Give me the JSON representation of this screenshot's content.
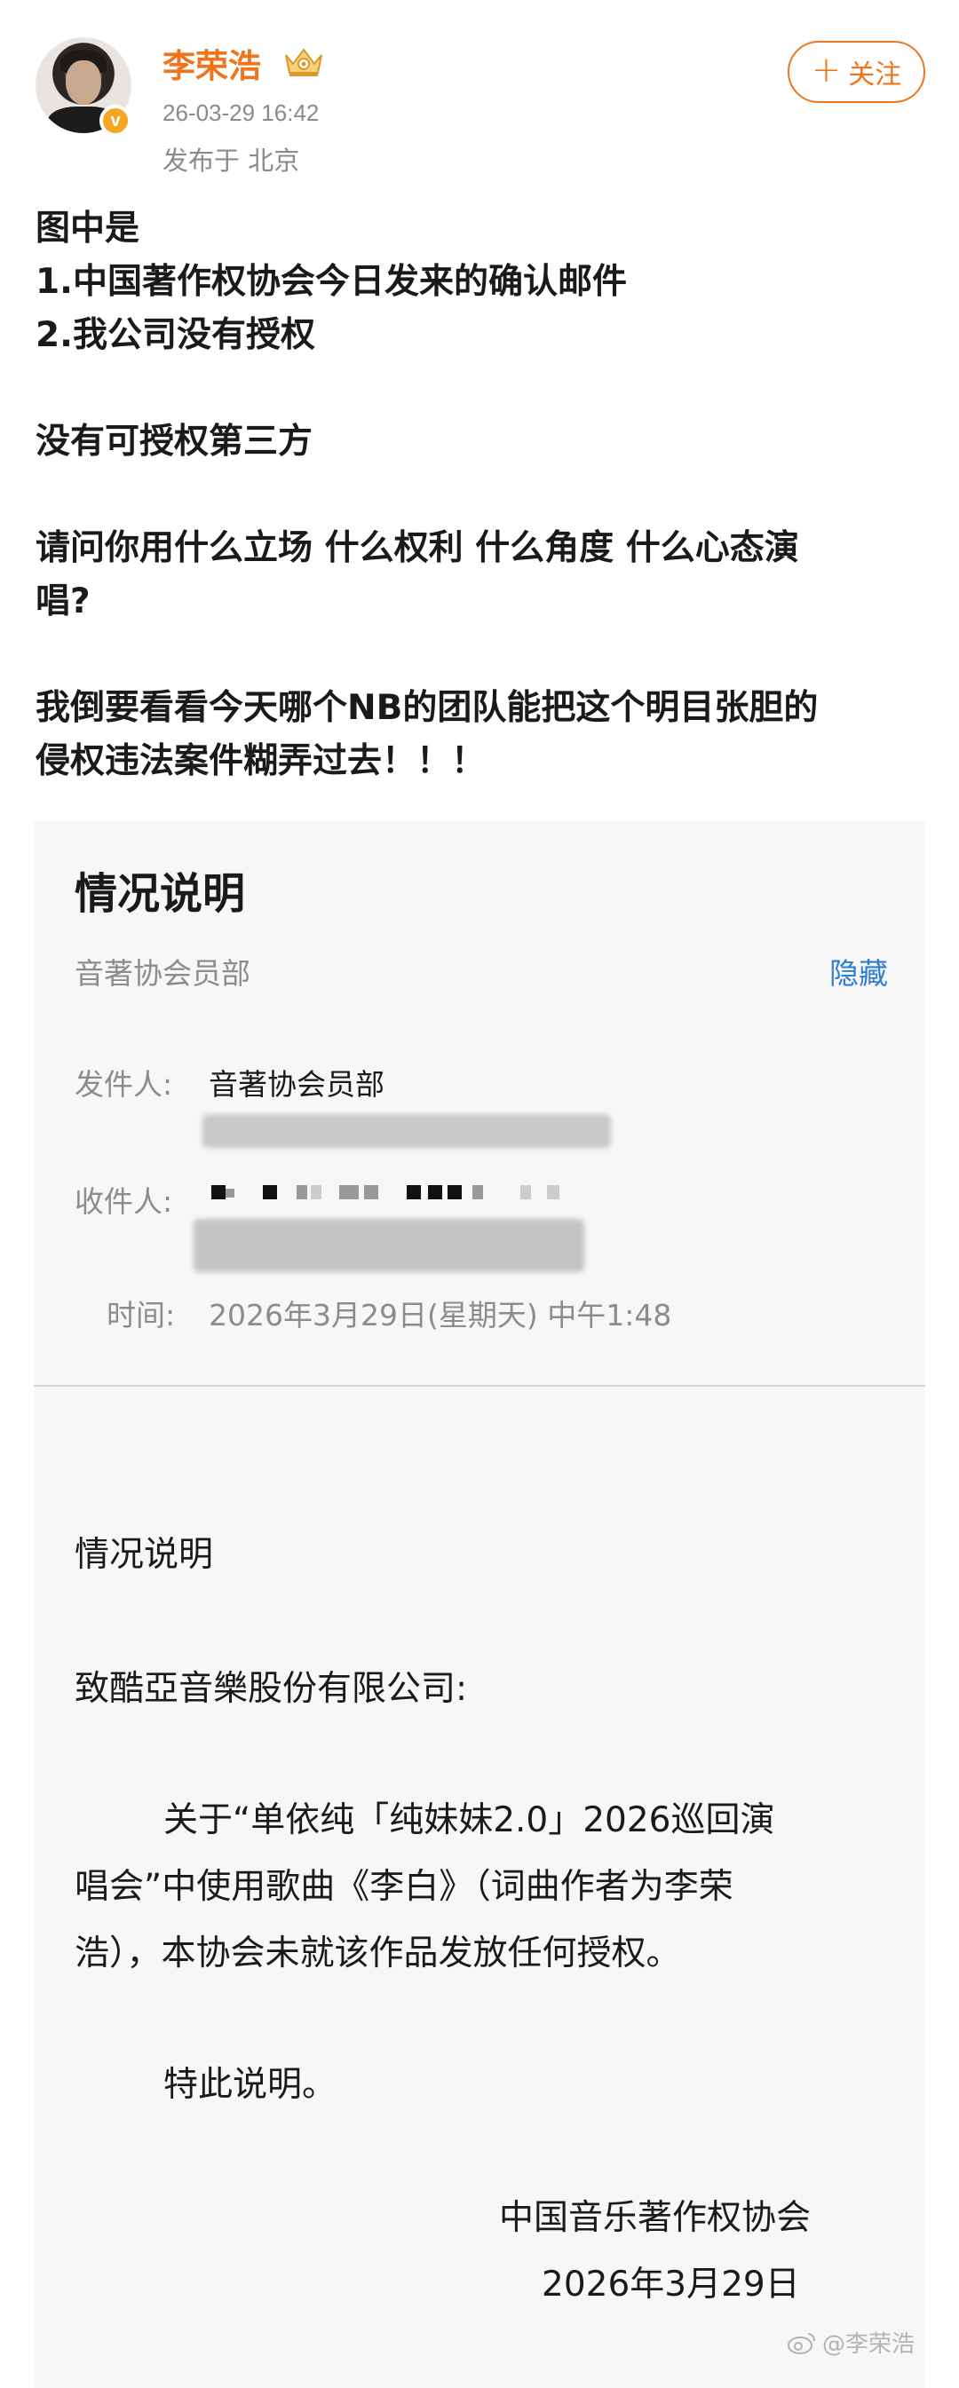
{
  "header": {
    "username": "李荣浩",
    "timestamp": "26-03-29 16:42",
    "location": "发布于 北京",
    "follow_label": "关注",
    "follow_plus": "+",
    "verified_mark": "v"
  },
  "post": {
    "lines": [
      "图中是",
      "1.中国著作权协会今日发来的确认邮件",
      "2.我公司没有授权",
      "",
      "没有可授权第三方",
      "",
      "请问你用什么立场 什么权利 什么角度 什么心态演",
      "唱?",
      "",
      "我倒要看看今天哪个NB的团队能把这个明目张胆的",
      "侵权违法案件糊弄过去！！！"
    ]
  },
  "document": {
    "title": "情况说明",
    "sender_top": "音著协会员部",
    "hide_label": "隐藏",
    "from_label": "发件人:",
    "from_value": "音著协会员部",
    "to_label": "收件人:",
    "time_label": "时间:",
    "time_value": "2026年3月29日(星期天) 中午1:48",
    "body_title": "情况说明",
    "addressee": "致酷亞音樂股份有限公司:",
    "para1_line1": "关于“单依纯「纯妹妹2.0」2026巡回演",
    "para1_line2": "唱会”中使用歌曲《李白》（词曲作者为李荣",
    "para1_line3": "浩），本协会未就该作品发放任何授权。",
    "para2": "特此说明。",
    "signature_org": "中国音乐著作权协会",
    "signature_date": "2026年3月29日",
    "watermark": "@李荣浩"
  },
  "colors": {
    "accent": "#f0741c",
    "link": "#2d7fd2",
    "meta": "#8a8a8a",
    "doc_bg": "#f7f7f7"
  },
  "icons": [
    "crown-badge-icon",
    "verified-icon",
    "plus-icon",
    "weibo-logo-icon"
  ]
}
